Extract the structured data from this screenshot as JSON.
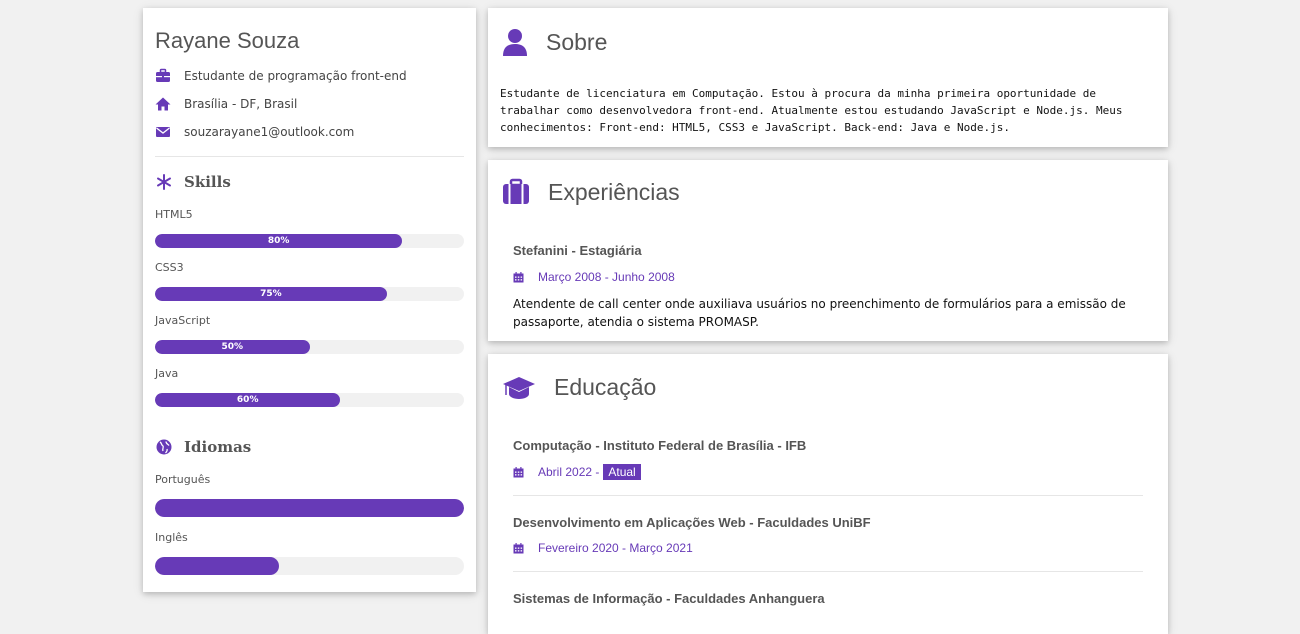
{
  "profile": {
    "name": "Rayane Souza",
    "role": "Estudante de programação front-end",
    "location": "Brasília - DF, Brasil",
    "email": "souzarayane1@outlook.com"
  },
  "skills": {
    "title": "Skills",
    "items": [
      {
        "label": "HTML5",
        "value": 0.8,
        "text": "80%"
      },
      {
        "label": "CSS3",
        "value": 0.75,
        "text": "75%"
      },
      {
        "label": "JavaScript",
        "value": 0.5,
        "text": "50%"
      },
      {
        "label": "Java",
        "value": 0.6,
        "text": "60%"
      }
    ]
  },
  "languages": {
    "title": "Idiomas",
    "items": [
      {
        "label": "Português",
        "value": 1.0
      },
      {
        "label": "Inglês",
        "value": 0.4
      }
    ]
  },
  "about": {
    "title": "Sobre",
    "text": "Estudante de licenciatura em Computação. Estou à procura da minha primeira oportunidade de trabalhar como desenvolvedora front-end. Atualmente estou estudando JavaScript e Node.js. Meus conhecimentos: Front-end: HTML5, CSS3 e JavaScript. Back-end: Java e Node.js."
  },
  "experience": {
    "title": "Experiências",
    "items": [
      {
        "title": "Stefanini - Estagiária",
        "date": "Março 2008 - Junho 2008",
        "description": "Atendente de call center onde auxiliava usuários no preenchimento de formulários para a emissão de passaporte, atendia o sistema PROMASP."
      }
    ]
  },
  "education": {
    "title": "Educação",
    "items": [
      {
        "title": "Computação - Instituto Federal de Brasília - IFB",
        "date": "Abril 2022 -",
        "tag": "Atual"
      },
      {
        "title": "Desenvolvimento em Aplicações Web - Faculdades UniBF",
        "date": "Fevereiro 2020 - Março 2021"
      },
      {
        "title": "Sistemas de Informação - Faculdades Anhanguera"
      }
    ]
  },
  "colors": {
    "accent": "#673ab7",
    "track": "#f1f1f1",
    "background": "#f1f1f1"
  }
}
